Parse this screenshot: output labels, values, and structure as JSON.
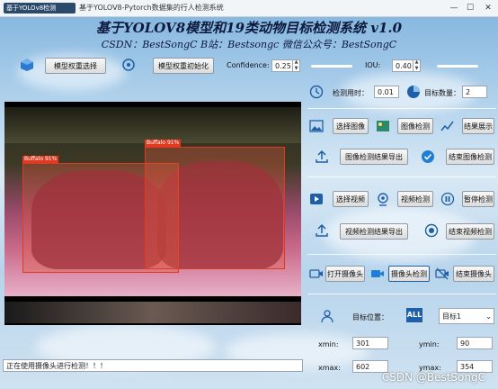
{
  "window": {
    "title": "基于YOLOV8-Pytorch数据集的行人检测系统",
    "logo_text": "基于YOLOv8检测",
    "minimize": "—",
    "maximize": "☐",
    "close": "✕"
  },
  "header": {
    "title": "基于YOLOV8模型和19类动物目标检测系统 v1.0",
    "subtitle": "CSDN：BestSongC   B站：Bestsongc   微信公众号：BestSongC"
  },
  "toolbar": {
    "model_select": "模型权重选择",
    "model_init": "模型权重初始化",
    "confidence_label": "Confidence:",
    "confidence_value": "0.25",
    "iou_label": "IOU:",
    "iou_value": "0.40"
  },
  "stats": {
    "time_label": "检测用时：",
    "time_value": "0.01",
    "count_label": "目标数量：",
    "count_value": "2"
  },
  "image_section": {
    "select": "选择图像",
    "detect": "图像检测",
    "show": "结果展示",
    "export": "图像检测结果导出",
    "end": "结束图像检测"
  },
  "video_section": {
    "select": "选择视频",
    "detect": "视频检测",
    "pause": "暂停检测",
    "export": "视频检测结果导出",
    "end": "结束视频检测"
  },
  "camera_section": {
    "open": "打开摄像头",
    "detect": "摄像头检测",
    "end": "结束摄像头"
  },
  "target": {
    "position_label": "目标位置：",
    "selected": "目标1",
    "xmin_label": "xmin:",
    "xmin": "301",
    "ymin_label": "ymin:",
    "ymin": "90",
    "xmax_label": "xmax:",
    "xmax": "602",
    "ymax_label": "ymax:",
    "ymax": "354"
  },
  "detections": [
    {
      "label": "Buffalo 91%"
    },
    {
      "label": "Buffalo 91%"
    }
  ],
  "status": "正在使用摄像头进行检测！！！",
  "watermark": "CSDN @BestSongC",
  "colors": {
    "accent": "#1f5fa8",
    "bbox": "#e03a20",
    "title": "#0d1a3d"
  }
}
